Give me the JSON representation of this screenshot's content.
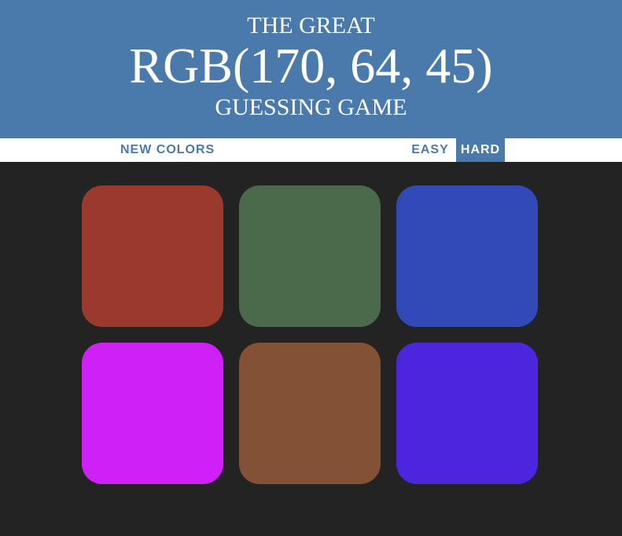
{
  "header": {
    "line1": "THE GREAT",
    "rgb_display": "RGB(170, 64, 45)",
    "line3": "GUESSING GAME",
    "background_color": "#4a7aab"
  },
  "stripe": {
    "new_colors_label": "NEW COLORS",
    "easy_label": "EASY",
    "hard_label": "HARD",
    "selected_mode": "HARD"
  },
  "squares": [
    {
      "color": "#993a2d"
    },
    {
      "color": "#4a6a4c"
    },
    {
      "color": "#3249b8"
    },
    {
      "color": "#d020f8"
    },
    {
      "color": "#835134"
    },
    {
      "color": "#4b26dc"
    }
  ]
}
